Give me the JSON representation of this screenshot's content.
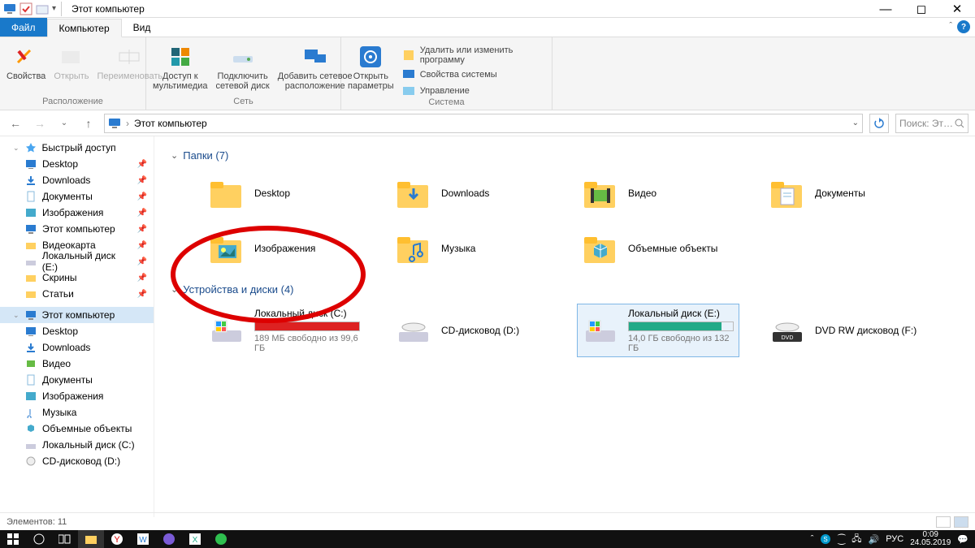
{
  "window": {
    "title": "Этот компьютер"
  },
  "tabs": {
    "file": "Файл",
    "computer": "Компьютер",
    "view": "Вид"
  },
  "ribbon": {
    "group_location": "Расположение",
    "group_network": "Сеть",
    "group_system": "Система",
    "properties": "Свойства",
    "open": "Открыть",
    "rename": "Переименовать",
    "media_access": "Доступ к\nмультимедиа",
    "map_drive": "Подключить\nсетевой диск",
    "add_location": "Добавить сетевое\nрасположение",
    "open_settings": "Открыть\nпараметры",
    "uninstall": "Удалить или изменить программу",
    "sys_props": "Свойства системы",
    "manage": "Управление"
  },
  "nav": {
    "breadcrumb": "Этот компьютер",
    "search_placeholder": "Поиск: Эт…"
  },
  "sidebar": {
    "quick": "Быстрый доступ",
    "items_pinned": [
      "Desktop",
      "Downloads",
      "Документы",
      "Изображения",
      "Этот компьютер",
      "Видеокарта",
      "Локальный диск (E:)",
      "Скрины",
      "Статьи"
    ],
    "this_pc": "Этот компьютер",
    "items_pc": [
      "Desktop",
      "Downloads",
      "Видео",
      "Документы",
      "Изображения",
      "Музыка",
      "Объемные объекты",
      "Локальный диск (C:)",
      "CD-дисковод (D:)"
    ]
  },
  "content": {
    "group_folders": "Папки (7)",
    "folders": [
      "Desktop",
      "Downloads",
      "Видео",
      "Документы",
      "Изображения",
      "Музыка",
      "Объемные объекты"
    ],
    "group_devices": "Устройства и диски (4)",
    "devices": [
      {
        "label": "Локальный диск (C:)",
        "sub": "189 МБ свободно из 99,6 ГБ",
        "fill": 0.998,
        "color": "#d22"
      },
      {
        "label": "CD-дисковод (D:)",
        "sub": "",
        "fill": 0,
        "color": ""
      },
      {
        "label": "Локальный диск (E:)",
        "sub": "14,0 ГБ свободно из 132 ГБ",
        "fill": 0.89,
        "color": "#2a8"
      },
      {
        "label": "DVD RW дисковод (F:)",
        "sub": "",
        "fill": 0,
        "color": ""
      }
    ],
    "selected_device": 2
  },
  "status": {
    "items": "Элементов: 11"
  },
  "taskbar": {
    "lang": "РУС",
    "time": "0:09",
    "date": "24.05.2019"
  }
}
